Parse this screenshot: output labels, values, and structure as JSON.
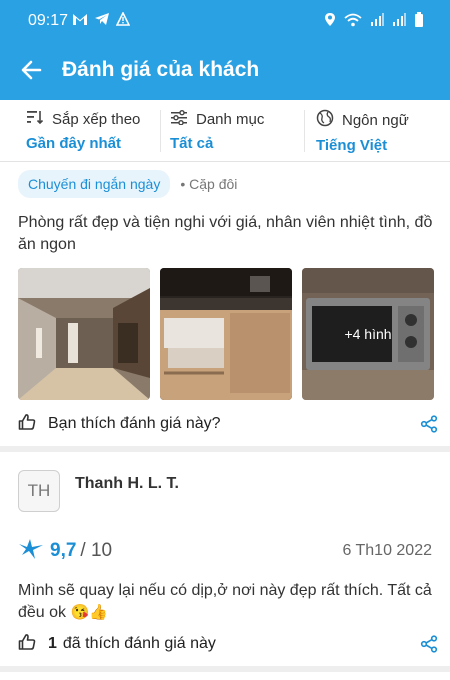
{
  "status_bar": {
    "time": "09:17",
    "left_icons": [
      "gmail-icon",
      "telegram-icon",
      "alert-icon"
    ],
    "right_icons": [
      "location-icon",
      "wifi-icon",
      "signal-icon",
      "signal-icon",
      "battery-icon"
    ]
  },
  "app_bar": {
    "title": "Đánh giá của khách",
    "back_icon": "arrow-left-icon"
  },
  "filters": [
    {
      "label": "Sắp xếp theo",
      "value": "Gần đây nhất",
      "icon": "sort-icon"
    },
    {
      "label": "Danh mục",
      "value": "Tất cả",
      "icon": "sliders-icon"
    },
    {
      "label": "Ngôn ngữ",
      "value": "Tiếng Việt",
      "icon": "globe-icon"
    }
  ],
  "review1": {
    "trip_tag": "Chuyến đi ngắn ngày",
    "traveler_type": "• Cặp đôi",
    "text": "Phòng rất đẹp và tiện nghi với giá, nhân viên nhiệt tình, đồ ăn ngon",
    "more_photos": "+4 hình",
    "like_label": "Bạn thích đánh giá này?"
  },
  "review2": {
    "avatar_initials": "TH",
    "author": "Thanh H. L. T.",
    "score": "9,7",
    "scale": "/ 10",
    "date": "6 Th10 2022",
    "text": "Mình sẽ quay lại nếu có dịp,ở nơi này đẹp rất thích. Tất cả đều ok",
    "emojis": "😘👍",
    "like_count": "1",
    "like_label": "đã thích đánh giá này"
  },
  "colors": {
    "brand": "#2aa1e3",
    "accent_text": "#1b8fd6",
    "tag_bg": "#e8f4fc"
  }
}
